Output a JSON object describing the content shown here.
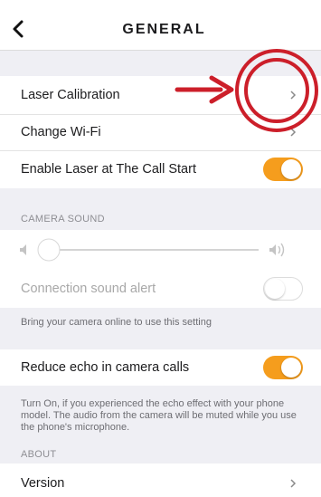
{
  "header": {
    "title": "GENERAL"
  },
  "rows": {
    "laser_calibration": "Laser Calibration",
    "change_wifi": "Change Wi-Fi",
    "enable_laser": "Enable Laser at The Call Start",
    "connection_sound": "Connection sound alert",
    "reduce_echo": "Reduce echo in camera calls",
    "version": "Version"
  },
  "toggles": {
    "enable_laser": true,
    "connection_sound": false,
    "reduce_echo": true
  },
  "camera_sound": {
    "header": "CAMERA SOUND",
    "volume_level": 0.0
  },
  "footers": {
    "connection_sound": "Bring your camera online to use this setting",
    "reduce_echo": "Turn On, if you experienced the echo effect with your phone model. The audio from the camera will be muted while you use the phone's microphone."
  },
  "about": {
    "header": "ABOUT"
  },
  "colors": {
    "accent": "#f59d1d",
    "annotation": "#cc1f2a"
  }
}
